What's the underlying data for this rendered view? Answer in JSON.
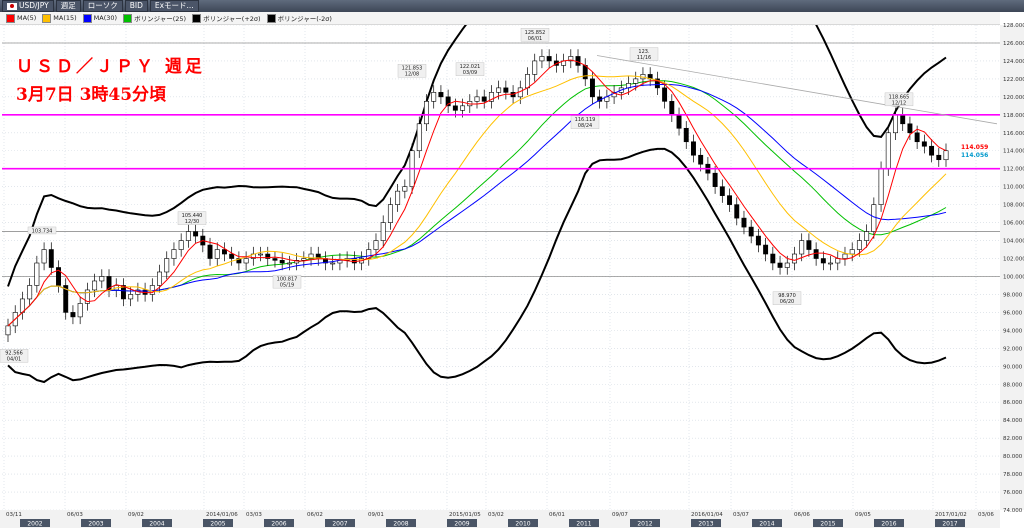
{
  "toolbar": {
    "symbol": "USD/JPY",
    "timeframe": "週足",
    "chart_type": "ローソク",
    "price_type": "BID",
    "mode": "Exモード..."
  },
  "indicators": [
    {
      "label": "MA(5)",
      "color": "#ff0000"
    },
    {
      "label": "MA(15)",
      "color": "#ffc000"
    },
    {
      "label": "MA(30)",
      "color": "#0000ff"
    },
    {
      "label": "ボリンジャー(25)",
      "color": "#00c000"
    },
    {
      "label": "ボリンジャー(+2σ)",
      "color": "#000000"
    },
    {
      "label": "ボリンジャー(-2σ)",
      "color": "#000000"
    }
  ],
  "annotation": {
    "line1": "ＵＳＤ／ＪＰＹ 週足",
    "line2": "3月7日 3時45分頃"
  },
  "colors": {
    "up_candle": "#ffffff",
    "down_candle": "#000000",
    "ma5": "#ff0000",
    "ma15": "#ffc000",
    "ma30": "#0000ff",
    "boll_mid": "#00c000",
    "boll_band": "#000000",
    "hline": "#ff00ff",
    "trendline": "#aaaaaa",
    "axis_bg": "#f2f2f2"
  },
  "chart_data": {
    "type": "candlestick",
    "ylim": [
      74.0,
      128.0
    ],
    "y_ticks": [
      "74.000",
      "76.000",
      "78.000",
      "80.000",
      "82.000",
      "84.000",
      "86.000",
      "88.000",
      "90.000",
      "92.000",
      "94.000",
      "96.000",
      "98.000",
      "100.000",
      "102.000",
      "104.000",
      "106.000",
      "108.000",
      "110.000",
      "112.000",
      "114.000",
      "116.000",
      "118.000",
      "120.000",
      "122.000",
      "124.000",
      "126.000",
      "128.000"
    ],
    "x_tick_labels": [
      {
        "label": "03/11",
        "pos": 0.02
      },
      {
        "label": "06/03",
        "pos": 0.63
      },
      {
        "label": "09/02",
        "pos": 1.24
      },
      {
        "label": "2014/01/06",
        "pos": 2.02
      },
      {
        "label": "03/03",
        "pos": 2.42
      },
      {
        "label": "06/02",
        "pos": 3.03
      },
      {
        "label": "09/01",
        "pos": 3.64
      },
      {
        "label": "2015/01/05",
        "pos": 4.45
      },
      {
        "label": "03/02",
        "pos": 4.84
      },
      {
        "label": "06/01",
        "pos": 5.45
      },
      {
        "label": "09/07",
        "pos": 6.08
      },
      {
        "label": "2016/01/04",
        "pos": 6.87
      },
      {
        "label": "03/07",
        "pos": 7.29
      },
      {
        "label": "06/06",
        "pos": 7.9
      },
      {
        "label": "09/05",
        "pos": 8.51
      },
      {
        "label": "2017/01/02",
        "pos": 9.31
      },
      {
        "label": "03/06",
        "pos": 9.74
      }
    ],
    "year_labels": [
      "2002",
      "2003",
      "2004",
      "2005",
      "2006",
      "2007",
      "2008",
      "2009",
      "2010",
      "2011",
      "2012",
      "2013",
      "2014",
      "2015",
      "2016",
      "2017"
    ],
    "horizontal_lines": [
      118.0,
      112.0
    ],
    "grey_lines": [
      126.0,
      105.0,
      100.0
    ],
    "trendline": {
      "from": {
        "pos": 5.95,
        "value": 124.6
      },
      "to": {
        "pos": 9.95,
        "value": 117.0
      }
    },
    "price_labels": [
      {
        "value": "114.059",
        "price": 114.059,
        "color": "#ff0000"
      },
      {
        "value": "114.056",
        "price": 114.056,
        "color": "#0099cc"
      }
    ],
    "annotations": [
      {
        "price": "92.566",
        "date": "04/01",
        "pos": 0.12,
        "value": 92.566
      },
      {
        "price": "103.734",
        "date": "",
        "pos": 0.4,
        "value": 103.734
      },
      {
        "price": "105.440",
        "date": "12/30",
        "pos": 1.9,
        "value": 105.44
      },
      {
        "price": "100.817",
        "date": "05/19",
        "pos": 2.85,
        "value": 100.817
      },
      {
        "price": "121.853",
        "date": "12/08",
        "pos": 4.1,
        "value": 121.853
      },
      {
        "price": "122.021",
        "date": "03/09",
        "pos": 4.68,
        "value": 122.021
      },
      {
        "price": "125.852",
        "date": "06/01",
        "pos": 5.33,
        "value": 125.852
      },
      {
        "price": "116.119",
        "date": "08/24",
        "pos": 5.83,
        "value": 116.119
      },
      {
        "price": "123.",
        "date": "11/16",
        "pos": 6.42,
        "value": 123.7
      },
      {
        "price": "98.970",
        "date": "06/20",
        "pos": 7.85,
        "value": 98.97
      },
      {
        "price": "118.665",
        "date": "12/12",
        "pos": 8.97,
        "value": 118.665
      }
    ],
    "closes": [
      94.5,
      96.0,
      97.5,
      99.0,
      101.5,
      103.0,
      101.0,
      99.0,
      96.0,
      95.5,
      97.0,
      98.5,
      99.5,
      100.0,
      98.5,
      99.0,
      97.5,
      98.0,
      98.5,
      98.0,
      99.0,
      100.5,
      102.0,
      103.0,
      104.0,
      105.0,
      104.5,
      103.5,
      102.0,
      103.0,
      102.5,
      102.0,
      101.5,
      102.0,
      102.5,
      102.5,
      102.0,
      101.8,
      101.5,
      101.5,
      101.8,
      102.0,
      102.5,
      102.0,
      101.5,
      101.5,
      101.8,
      102.0,
      101.5,
      102.0,
      103.0,
      104.0,
      106.0,
      108.0,
      109.5,
      110.0,
      114.0,
      117.0,
      119.5,
      120.5,
      120.0,
      119.0,
      118.5,
      119.0,
      119.5,
      120.0,
      119.5,
      120.5,
      121.0,
      120.5,
      120.0,
      121.0,
      122.5,
      124.0,
      124.5,
      124.0,
      123.5,
      124.0,
      124.5,
      123.5,
      122.0,
      120.0,
      119.5,
      120.0,
      120.5,
      121.0,
      121.5,
      122.0,
      122.5,
      122.0,
      121.0,
      119.5,
      118.0,
      116.5,
      115.0,
      113.5,
      112.5,
      111.5,
      110.0,
      109.0,
      108.0,
      106.5,
      105.5,
      104.5,
      103.5,
      102.5,
      101.5,
      101.0,
      101.5,
      102.5,
      104.0,
      103.0,
      102.0,
      101.5,
      101.5,
      102.0,
      102.5,
      103.0,
      104.0,
      105.0,
      108.0,
      112.0,
      116.0,
      118.0,
      117.0,
      116.0,
      115.0,
      114.5,
      113.5,
      113.0,
      114.0
    ]
  }
}
